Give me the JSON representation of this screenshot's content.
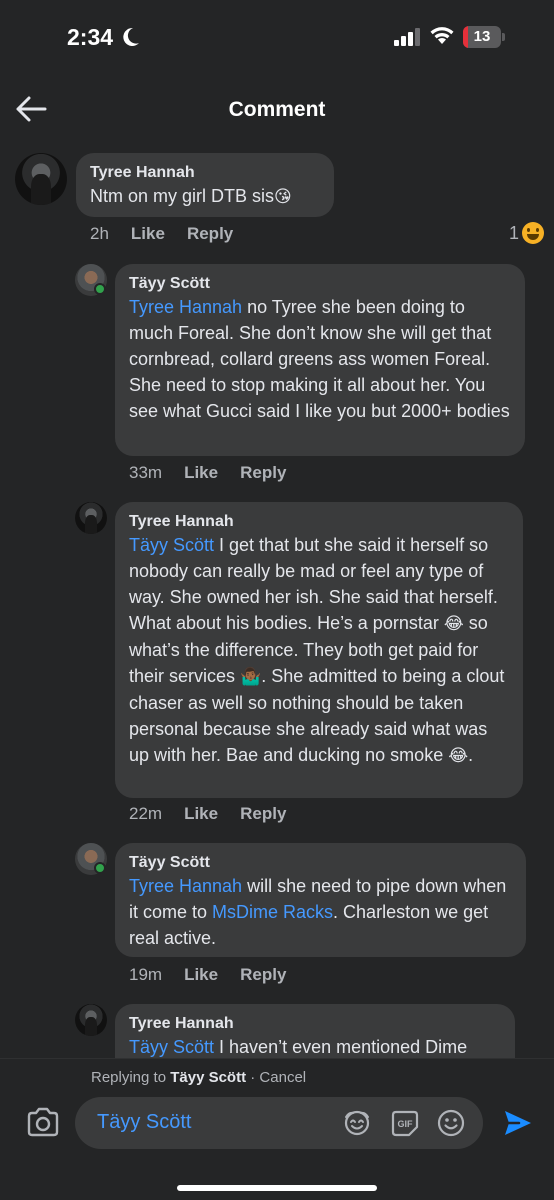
{
  "status_bar": {
    "time": "2:34",
    "battery": "13",
    "battery_level": 0.13
  },
  "header": {
    "title": "Comment"
  },
  "comments": [
    {
      "author": "Tyree Hannah",
      "text": "Ntm on my girl DTB sis",
      "emoji": "😘",
      "time": "2h",
      "like": "Like",
      "reply": "Reply",
      "reaction_count": "1",
      "reaction_icon": "laughing-emoji"
    },
    {
      "author": "Täyy Scött",
      "mention": "Tyree Hannah",
      "text": " no Tyree she been doing to much Foreal. She don’t know she will get that cornbread, collard greens ass women Foreal. She need to stop making it all about her. You see what Gucci said I like you but 2000+ bodies",
      "time": "33m",
      "like": "Like",
      "reply": "Reply"
    },
    {
      "author": "Tyree Hannah",
      "mention": "Täyy Scött",
      "text_a": " I get that but she said it herself so nobody can really be mad or feel any type of way. She owned her ish. She said that herself. What about his bodies. He’s a pornstar ",
      "emoji_a": "😂",
      "text_b": " so what’s the difference. They both get paid for their services ",
      "emoji_b": "🤷🏾‍♂️",
      "text_c": ". She admitted to being a clout chaser as well so nothing should be taken personal because she already said what was up with her. Bae and ducking no smoke ",
      "emoji_c": "😂",
      "text_d": ".",
      "time": "22m",
      "like": "Like",
      "reply": "Reply"
    },
    {
      "author": "Täyy Scött",
      "mention": "Tyree Hannah",
      "text_a": " will she need to pipe down when it come to ",
      "mention_b": "MsDime Racks",
      "text_b": ". Charleston we get real active.",
      "time": "19m",
      "like": "Like",
      "reply": "Reply"
    },
    {
      "author": "Tyree Hannah",
      "mention": "Täyy Scött",
      "text": " I haven’t even mentioned Dime"
    }
  ],
  "composer": {
    "replying_prefix": "Replying to ",
    "replying_name": "Täyy Scött",
    "separator": " · ",
    "cancel": "Cancel",
    "input_value": "Täyy Scött"
  },
  "colors": {
    "background": "#242526",
    "bubble": "#3a3b3c",
    "mention": "#4599ff",
    "send": "#1a8cff",
    "online": "#31a24c"
  }
}
